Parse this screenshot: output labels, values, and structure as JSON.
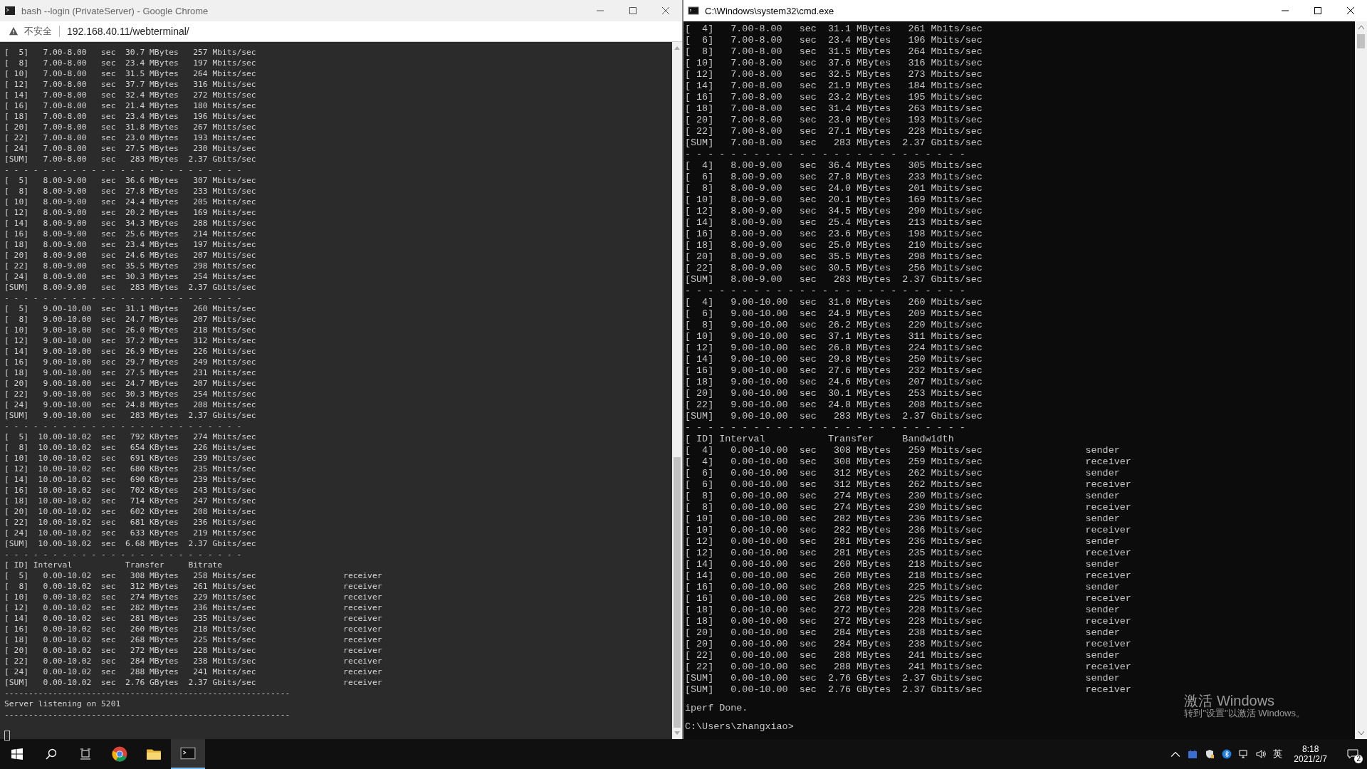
{
  "browser_window": {
    "title": "bash --login (PrivateServer) - Google Chrome",
    "security_label": "不安全",
    "url": "192.168.40.11/webterminal/",
    "terminal_lines": [
      "[  5]   7.00-8.00   sec  30.7 MBytes   257 Mbits/sec",
      "[  8]   7.00-8.00   sec  23.4 MBytes   197 Mbits/sec",
      "[ 10]   7.00-8.00   sec  31.5 MBytes   264 Mbits/sec",
      "[ 12]   7.00-8.00   sec  37.7 MBytes   316 Mbits/sec",
      "[ 14]   7.00-8.00   sec  32.4 MBytes   272 Mbits/sec",
      "[ 16]   7.00-8.00   sec  21.4 MBytes   180 Mbits/sec",
      "[ 18]   7.00-8.00   sec  23.4 MBytes   196 Mbits/sec",
      "[ 20]   7.00-8.00   sec  31.8 MBytes   267 Mbits/sec",
      "[ 22]   7.00-8.00   sec  23.0 MBytes   193 Mbits/sec",
      "[ 24]   7.00-8.00   sec  27.5 MBytes   230 Mbits/sec",
      "[SUM]   7.00-8.00   sec   283 MBytes  2.37 Gbits/sec",
      "- - - - - - - - - - - - - - - - - - - - - - - - -",
      "[  5]   8.00-9.00   sec  36.6 MBytes   307 Mbits/sec",
      "[  8]   8.00-9.00   sec  27.8 MBytes   233 Mbits/sec",
      "[ 10]   8.00-9.00   sec  24.4 MBytes   205 Mbits/sec",
      "[ 12]   8.00-9.00   sec  20.2 MBytes   169 Mbits/sec",
      "[ 14]   8.00-9.00   sec  34.3 MBytes   288 Mbits/sec",
      "[ 16]   8.00-9.00   sec  25.6 MBytes   214 Mbits/sec",
      "[ 18]   8.00-9.00   sec  23.4 MBytes   197 Mbits/sec",
      "[ 20]   8.00-9.00   sec  24.6 MBytes   207 Mbits/sec",
      "[ 22]   8.00-9.00   sec  35.5 MBytes   298 Mbits/sec",
      "[ 24]   8.00-9.00   sec  30.3 MBytes   254 Mbits/sec",
      "[SUM]   8.00-9.00   sec   283 MBytes  2.37 Gbits/sec",
      "- - - - - - - - - - - - - - - - - - - - - - - - -",
      "[  5]   9.00-10.00  sec  31.1 MBytes   260 Mbits/sec",
      "[  8]   9.00-10.00  sec  24.7 MBytes   207 Mbits/sec",
      "[ 10]   9.00-10.00  sec  26.0 MBytes   218 Mbits/sec",
      "[ 12]   9.00-10.00  sec  37.2 MBytes   312 Mbits/sec",
      "[ 14]   9.00-10.00  sec  26.9 MBytes   226 Mbits/sec",
      "[ 16]   9.00-10.00  sec  29.7 MBytes   249 Mbits/sec",
      "[ 18]   9.00-10.00  sec  27.5 MBytes   231 Mbits/sec",
      "[ 20]   9.00-10.00  sec  24.7 MBytes   207 Mbits/sec",
      "[ 22]   9.00-10.00  sec  30.3 MBytes   254 Mbits/sec",
      "[ 24]   9.00-10.00  sec  24.8 MBytes   208 Mbits/sec",
      "[SUM]   9.00-10.00  sec   283 MBytes  2.37 Gbits/sec",
      "- - - - - - - - - - - - - - - - - - - - - - - - -",
      "[  5]  10.00-10.02  sec   792 KBytes   274 Mbits/sec",
      "[  8]  10.00-10.02  sec   654 KBytes   226 Mbits/sec",
      "[ 10]  10.00-10.02  sec   691 KBytes   239 Mbits/sec",
      "[ 12]  10.00-10.02  sec   680 KBytes   235 Mbits/sec",
      "[ 14]  10.00-10.02  sec   690 KBytes   239 Mbits/sec",
      "[ 16]  10.00-10.02  sec   702 KBytes   243 Mbits/sec",
      "[ 18]  10.00-10.02  sec   714 KBytes   247 Mbits/sec",
      "[ 20]  10.00-10.02  sec   602 KBytes   208 Mbits/sec",
      "[ 22]  10.00-10.02  sec   681 KBytes   236 Mbits/sec",
      "[ 24]  10.00-10.02  sec   633 KBytes   219 Mbits/sec",
      "[SUM]  10.00-10.02  sec  6.68 MBytes  2.37 Gbits/sec",
      "- - - - - - - - - - - - - - - - - - - - - - - - -",
      "[ ID] Interval           Transfer     Bitrate",
      "[  5]   0.00-10.02  sec   308 MBytes   258 Mbits/sec                  receiver",
      "[  8]   0.00-10.02  sec   312 MBytes   261 Mbits/sec                  receiver",
      "[ 10]   0.00-10.02  sec   274 MBytes   229 Mbits/sec                  receiver",
      "[ 12]   0.00-10.02  sec   282 MBytes   236 Mbits/sec                  receiver",
      "[ 14]   0.00-10.02  sec   281 MBytes   235 Mbits/sec                  receiver",
      "[ 16]   0.00-10.02  sec   260 MBytes   218 Mbits/sec                  receiver",
      "[ 18]   0.00-10.02  sec   268 MBytes   225 Mbits/sec                  receiver",
      "[ 20]   0.00-10.02  sec   272 MBytes   228 Mbits/sec                  receiver",
      "[ 22]   0.00-10.02  sec   284 MBytes   238 Mbits/sec                  receiver",
      "[ 24]   0.00-10.02  sec   288 MBytes   241 Mbits/sec                  receiver",
      "[SUM]   0.00-10.02  sec  2.76 GBytes  2.37 Gbits/sec                  receiver",
      "-----------------------------------------------------------",
      "Server listening on 5201",
      "-----------------------------------------------------------"
    ]
  },
  "cmd_window": {
    "title": "C:\\Windows\\system32\\cmd.exe",
    "terminal_lines": [
      "[  4]   7.00-8.00   sec  31.1 MBytes   261 Mbits/sec",
      "[  6]   7.00-8.00   sec  23.4 MBytes   196 Mbits/sec",
      "[  8]   7.00-8.00   sec  31.5 MBytes   264 Mbits/sec",
      "[ 10]   7.00-8.00   sec  37.6 MBytes   316 Mbits/sec",
      "[ 12]   7.00-8.00   sec  32.5 MBytes   273 Mbits/sec",
      "[ 14]   7.00-8.00   sec  21.9 MBytes   184 Mbits/sec",
      "[ 16]   7.00-8.00   sec  23.2 MBytes   195 Mbits/sec",
      "[ 18]   7.00-8.00   sec  31.4 MBytes   263 Mbits/sec",
      "[ 20]   7.00-8.00   sec  23.0 MBytes   193 Mbits/sec",
      "[ 22]   7.00-8.00   sec  27.1 MBytes   228 Mbits/sec",
      "[SUM]   7.00-8.00   sec   283 MBytes  2.37 Gbits/sec",
      "- - - - - - - - - - - - - - - - - - - - - - - - -",
      "[  4]   8.00-9.00   sec  36.4 MBytes   305 Mbits/sec",
      "[  6]   8.00-9.00   sec  27.8 MBytes   233 Mbits/sec",
      "[  8]   8.00-9.00   sec  24.0 MBytes   201 Mbits/sec",
      "[ 10]   8.00-9.00   sec  20.1 MBytes   169 Mbits/sec",
      "[ 12]   8.00-9.00   sec  34.5 MBytes   290 Mbits/sec",
      "[ 14]   8.00-9.00   sec  25.4 MBytes   213 Mbits/sec",
      "[ 16]   8.00-9.00   sec  23.6 MBytes   198 Mbits/sec",
      "[ 18]   8.00-9.00   sec  25.0 MBytes   210 Mbits/sec",
      "[ 20]   8.00-9.00   sec  35.5 MBytes   298 Mbits/sec",
      "[ 22]   8.00-9.00   sec  30.5 MBytes   256 Mbits/sec",
      "[SUM]   8.00-9.00   sec   283 MBytes  2.37 Gbits/sec",
      "- - - - - - - - - - - - - - - - - - - - - - - - -",
      "[  4]   9.00-10.00  sec  31.0 MBytes   260 Mbits/sec",
      "[  6]   9.00-10.00  sec  24.9 MBytes   209 Mbits/sec",
      "[  8]   9.00-10.00  sec  26.2 MBytes   220 Mbits/sec",
      "[ 10]   9.00-10.00  sec  37.1 MBytes   311 Mbits/sec",
      "[ 12]   9.00-10.00  sec  26.8 MBytes   224 Mbits/sec",
      "[ 14]   9.00-10.00  sec  29.8 MBytes   250 Mbits/sec",
      "[ 16]   9.00-10.00  sec  27.6 MBytes   232 Mbits/sec",
      "[ 18]   9.00-10.00  sec  24.6 MBytes   207 Mbits/sec",
      "[ 20]   9.00-10.00  sec  30.1 MBytes   253 Mbits/sec",
      "[ 22]   9.00-10.00  sec  24.8 MBytes   208 Mbits/sec",
      "[SUM]   9.00-10.00  sec   283 MBytes  2.37 Gbits/sec",
      "- - - - - - - - - - - - - - - - - - - - - - - - -",
      "[ ID] Interval           Transfer     Bandwidth",
      "[  4]   0.00-10.00  sec   308 MBytes   259 Mbits/sec                  sender",
      "[  4]   0.00-10.00  sec   308 MBytes   259 Mbits/sec                  receiver",
      "[  6]   0.00-10.00  sec   312 MBytes   262 Mbits/sec                  sender",
      "[  6]   0.00-10.00  sec   312 MBytes   262 Mbits/sec                  receiver",
      "[  8]   0.00-10.00  sec   274 MBytes   230 Mbits/sec                  sender",
      "[  8]   0.00-10.00  sec   274 MBytes   230 Mbits/sec                  receiver",
      "[ 10]   0.00-10.00  sec   282 MBytes   236 Mbits/sec                  sender",
      "[ 10]   0.00-10.00  sec   282 MBytes   236 Mbits/sec                  receiver",
      "[ 12]   0.00-10.00  sec   281 MBytes   236 Mbits/sec                  sender",
      "[ 12]   0.00-10.00  sec   281 MBytes   235 Mbits/sec                  receiver",
      "[ 14]   0.00-10.00  sec   260 MBytes   218 Mbits/sec                  sender",
      "[ 14]   0.00-10.00  sec   260 MBytes   218 Mbits/sec                  receiver",
      "[ 16]   0.00-10.00  sec   268 MBytes   225 Mbits/sec                  sender",
      "[ 16]   0.00-10.00  sec   268 MBytes   225 Mbits/sec                  receiver",
      "[ 18]   0.00-10.00  sec   272 MBytes   228 Mbits/sec                  sender",
      "[ 18]   0.00-10.00  sec   272 MBytes   228 Mbits/sec                  receiver",
      "[ 20]   0.00-10.00  sec   284 MBytes   238 Mbits/sec                  sender",
      "[ 20]   0.00-10.00  sec   284 MBytes   238 Mbits/sec                  receiver",
      "[ 22]   0.00-10.00  sec   288 MBytes   241 Mbits/sec                  sender",
      "[ 22]   0.00-10.00  sec   288 MBytes   241 Mbits/sec                  receiver",
      "[SUM]   0.00-10.00  sec  2.76 GBytes  2.37 Gbits/sec                  sender",
      "[SUM]   0.00-10.00  sec  2.76 GBytes  2.37 Gbits/sec                  receiver"
    ],
    "done_message": "iperf Done.",
    "prompt": "C:\\Users\\zhangxiao>"
  },
  "activation_notice": {
    "title": "激活 Windows",
    "hint": "转到\"设置\"以激活 Windows。"
  },
  "taskbar": {
    "input_method": "英",
    "time": "8:18",
    "date": "2021/2/7",
    "notification_count": "2"
  }
}
